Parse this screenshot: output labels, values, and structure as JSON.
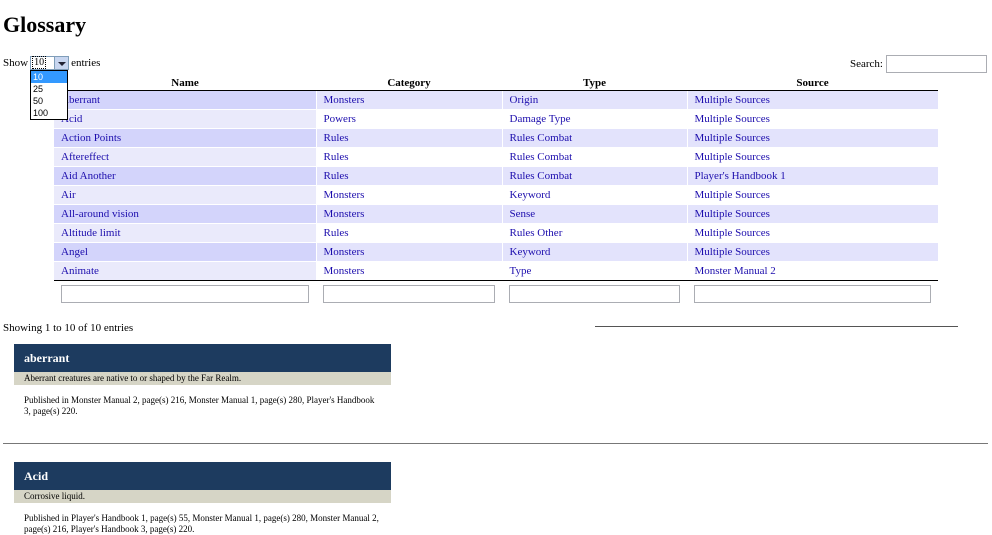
{
  "page": {
    "title": "Glossary"
  },
  "length_menu": {
    "show_label": "Show",
    "entries_label": "entries",
    "selected": "10",
    "options": [
      "10",
      "25",
      "50",
      "100"
    ]
  },
  "search": {
    "label": "Search:",
    "value": ""
  },
  "table": {
    "columns": [
      "Name",
      "Category",
      "Type",
      "Source"
    ],
    "rows": [
      {
        "name": "Aberrant",
        "category": "Monsters",
        "type": "Origin",
        "source": "Multiple Sources"
      },
      {
        "name": "Acid",
        "category": "Powers",
        "type": "Damage Type",
        "source": "Multiple Sources"
      },
      {
        "name": "Action Points",
        "category": "Rules",
        "type": "Rules Combat",
        "source": "Multiple Sources"
      },
      {
        "name": "Aftereffect",
        "category": "Rules",
        "type": "Rules Combat",
        "source": "Multiple Sources"
      },
      {
        "name": "Aid Another",
        "category": "Rules",
        "type": "Rules Combat",
        "source": "Player's Handbook 1"
      },
      {
        "name": "Air",
        "category": "Monsters",
        "type": "Keyword",
        "source": "Multiple Sources"
      },
      {
        "name": "All-around vision",
        "category": "Monsters",
        "type": "Sense",
        "source": "Multiple Sources"
      },
      {
        "name": "Altitude limit",
        "category": "Rules",
        "type": "Rules Other",
        "source": "Multiple Sources"
      },
      {
        "name": "Angel",
        "category": "Monsters",
        "type": "Keyword",
        "source": "Multiple Sources"
      },
      {
        "name": "Animate",
        "category": "Monsters",
        "type": "Type",
        "source": "Monster Manual 2"
      }
    ],
    "filters": [
      "",
      "",
      "",
      ""
    ]
  },
  "info": {
    "text": "Showing 1 to 10 of 10 entries"
  },
  "details": [
    {
      "title": "aberrant",
      "flavor": "Aberrant creatures are native to or shaped by the Far Realm.",
      "published": "Published in Monster Manual 2, page(s) 216, Monster Manual 1, page(s) 280, Player's Handbook 3, page(s) 220."
    },
    {
      "title": "Acid",
      "flavor": "Corrosive liquid.",
      "published": "Published in Player's Handbook 1, page(s) 55, Monster Manual 1, page(s) 280, Monster Manual 2, page(s) 216, Player's Handbook 3, page(s) 220."
    }
  ]
}
